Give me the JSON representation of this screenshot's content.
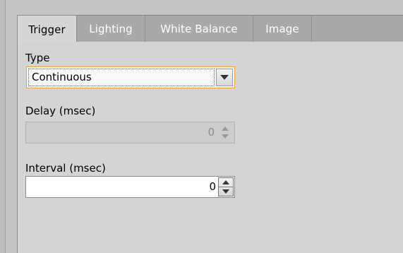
{
  "tabs": [
    {
      "label": "Trigger"
    },
    {
      "label": "Lighting"
    },
    {
      "label": "White Balance"
    },
    {
      "label": "Image"
    }
  ],
  "trigger": {
    "type_label": "Type",
    "type_value": "Continuous",
    "delay_label": "Delay (msec)",
    "delay_value": "0",
    "interval_label": "Interval (msec)",
    "interval_value": "0"
  },
  "colors": {
    "focus_border": "#e6a243",
    "tab_inactive_text": "#ffffff",
    "panel_bg": "#d4d4d4"
  },
  "icons": {
    "dropdown": "chevron-down-icon",
    "spin_up": "arrow-up-icon",
    "spin_down": "arrow-down-icon"
  }
}
